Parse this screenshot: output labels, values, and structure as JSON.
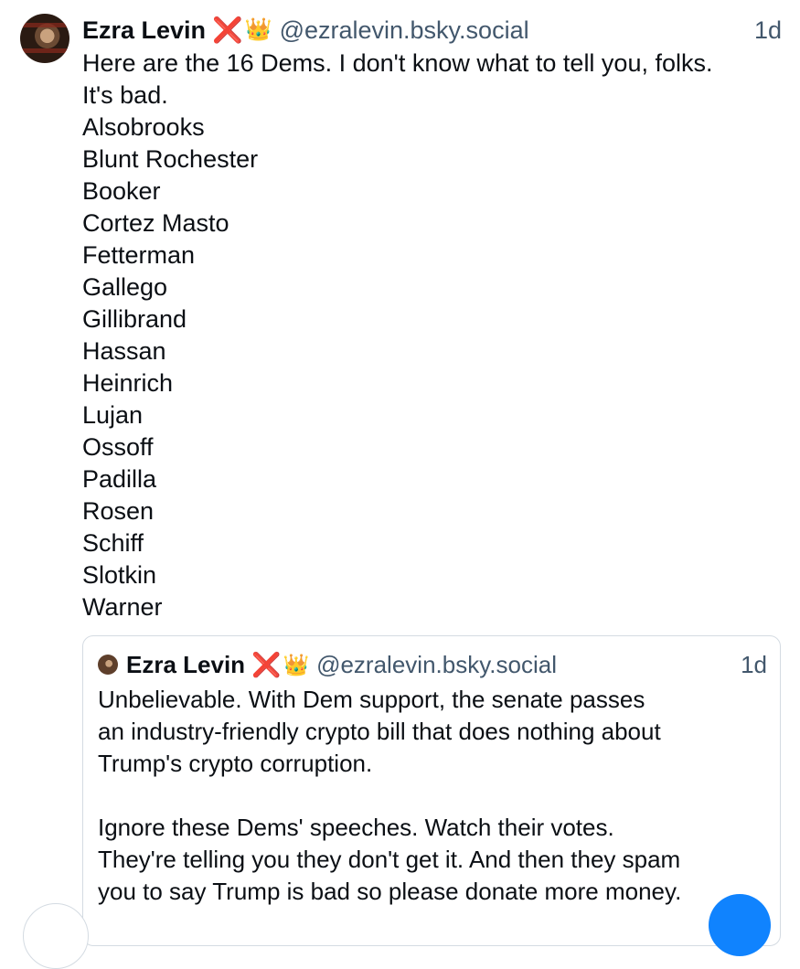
{
  "post": {
    "author_name": "Ezra Levin",
    "author_handle": "@ezralevin.bsky.social",
    "time": "1d",
    "badges": {
      "x": "❌",
      "crown": "👑"
    },
    "lines": [
      "Here are the 16 Dems. I don't know what to tell you, folks.",
      "It's bad.",
      "Alsobrooks",
      "Blunt Rochester",
      "Booker",
      "Cortez Masto",
      "Fetterman",
      "Gallego",
      "Gillibrand",
      "Hassan",
      "Heinrich",
      "Lujan",
      "Ossoff",
      "Padilla",
      "Rosen",
      "Schiff",
      "Slotkin",
      "Warner"
    ]
  },
  "quote": {
    "author_name": "Ezra Levin",
    "author_handle": "@ezralevin.bsky.social",
    "time": "1d",
    "badges": {
      "x": "❌",
      "crown": "👑"
    },
    "lines": [
      "Unbelievable. With Dem support, the senate passes",
      "an industry-friendly crypto bill that does nothing about",
      "Trump's crypto corruption.",
      "",
      "Ignore these Dems' speeches. Watch their votes.",
      "They're telling you they don't get it. And then they spam",
      "you to say Trump is bad so please donate more money."
    ]
  },
  "colors": {
    "text": "#0b0f14",
    "muted": "#42576c",
    "border": "#d4dbe2",
    "accent": "#1083fe",
    "x_badge": "#e0202a",
    "crown_badge": "#e8a317"
  },
  "icons": {
    "avatar": "profile-photo",
    "fab": "compose-button"
  }
}
